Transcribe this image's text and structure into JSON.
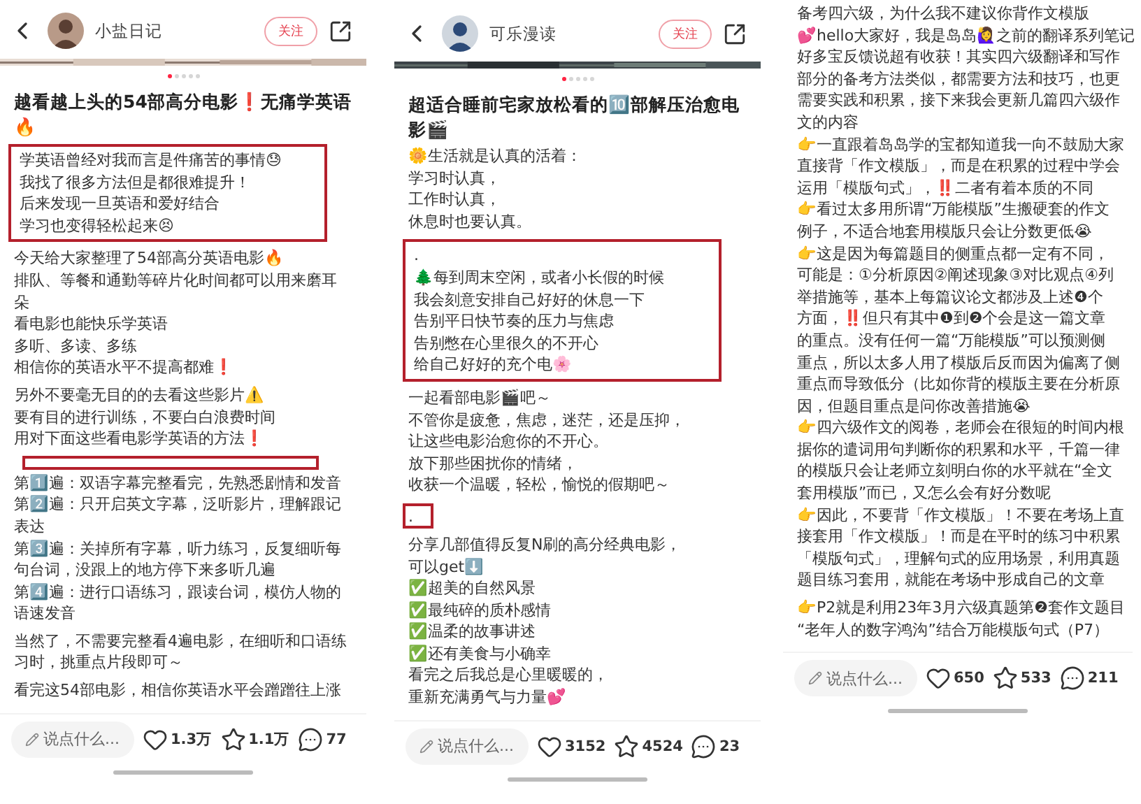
{
  "panels": [
    {
      "header": {
        "author": "小盐日记",
        "follow": "关注"
      },
      "image": {
        "kind": "picture"
      },
      "dots": [
        {
          "selected": true
        },
        {
          "selected": false
        },
        {
          "selected": false
        },
        {
          "selected": false
        },
        {
          "selected": false
        }
      ],
      "title": [
        "越看越上头的54部高分电影❗无痛学英语",
        "🔥"
      ],
      "blocks": [
        {
          "kind": "boxed",
          "lines": [
            "学英语曾经对我而言是件痛苦的事情😓",
            "我找了很多方法但是都很难提升！",
            "后来发现一旦英语和爱好结合",
            "学习也变得轻松起来😣"
          ]
        },
        {
          "kind": "para",
          "lines": [
            "今天给大家整理了54部高分英语电影🔥",
            "排队、等餐和通勤等碎片化时间都可以用来磨耳",
            "朵",
            "看电影也能快乐学英语",
            "多听、多读、多练",
            "相信你的英语水平不提高都难❗"
          ]
        },
        {
          "kind": "para",
          "lines": [
            "另外不要毫无目的的去看这些影片⚠️",
            "要有目的进行训练，不要白白浪费时间",
            "用对下面这些看电影学英语的方法❗"
          ]
        },
        {
          "kind": "empty_box"
        },
        {
          "kind": "para",
          "lines": [
            "第1️⃣遍：双语字幕完整看完，先熟悉剧情和发音",
            "第2️⃣遍：只开启英文字幕，泛听影片，理解跟记",
            "表达",
            "第3️⃣遍：关掉所有字幕，听力练习，反复细听每",
            "句台词，没跟上的地方停下来多听几遍",
            "第4️⃣遍：进行口语练习，跟读台词，模仿人物的",
            "语速发音"
          ]
        },
        {
          "kind": "para",
          "lines": [
            "当然了，不需要完整看4遍电影，在细听和口语练",
            "习时，挑重点片段即可～"
          ]
        },
        {
          "kind": "para",
          "lines": [
            "看完这54部电影，相信你英语水平会蹭蹭往上涨"
          ]
        }
      ],
      "footer": {
        "placeholder": "说点什么...",
        "likes": "1.3万",
        "favorites": "1.1万",
        "comments": "77"
      }
    },
    {
      "header": {
        "author": "可乐漫读",
        "follow": "关注"
      },
      "image": {
        "kind": "picture"
      },
      "dots": [
        {
          "selected": true
        },
        {
          "selected": false
        },
        {
          "selected": false
        },
        {
          "selected": false
        },
        {
          "selected": false
        }
      ],
      "title": [
        "超适合睡前宅家放松看的🔟部解压治愈电",
        "影🎬"
      ],
      "blocks": [
        {
          "kind": "para",
          "lines": [
            "🌼生活就是认真的活着：",
            "学习时认真，",
            "工作时认真，",
            "休息时也要认真。"
          ]
        },
        {
          "kind": "boxed",
          "lines": [
            ".",
            "🌲每到周末空闲，或者小长假的时候",
            "我会刻意安排自己好好的休息一下",
            "告别平日快节奏的压力与焦虑",
            "告别憋在心里很久的不开心",
            "给自己好好的充个电🌸"
          ]
        },
        {
          "kind": "para",
          "lines": [
            "一起看部电影🎬吧～",
            "不管你是疲惫，焦虑，迷茫，还是压抑，",
            "让这些电影治愈你的不开心。",
            "放下那些困扰你的情绪，",
            "收获一个温暖，轻松，愉悦的假期吧～"
          ]
        },
        {
          "kind": "boxed",
          "lines": [
            "."
          ]
        },
        {
          "kind": "para",
          "lines": [
            "分享几部值得反复N刷的高分经典电影，",
            "可以get⬇️",
            "✅超美的自然风景",
            "✅最纯碎的质朴感情",
            "✅温柔的故事讲述",
            "✅还有美食与小确幸",
            "看完之后我总是心里暖暖的，",
            "重新充满勇气与力量💕"
          ]
        }
      ],
      "footer": {
        "placeholder": "说点什么...",
        "likes": "3152",
        "favorites": "4524",
        "comments": "23"
      }
    },
    {
      "blocks": [
        {
          "kind": "para",
          "lines": [
            "备考四六级，为什么我不建议你背作文模版",
            "💕hello大家好，我是岛岛🙋‍♀️之前的翻译系列笔记",
            "好多宝反馈说超有收获！其实四六级翻译和写作",
            "部分的备考方法类似，都需要方法和技巧，也更",
            "需要实践和积累，接下来我会更新几篇四六级作",
            "文的内容",
            "👉一直跟着岛岛学的宝都知道我一向不鼓励大家",
            "直接背「作文模版」，而是在积累的过程中学会",
            "运用「模版句式」，‼️二者有着本质的不同",
            "👉看过太多用所谓“万能模版”生搬硬套的作文",
            "例子，不适合地套用模版只会让分数更低😭",
            "👉这是因为每篇题目的侧重点都一定有不同，",
            "可能是：①分析原因②阐述现象③对比观点④列",
            "举措施等，基本上每篇议论文都涉及上述❹个",
            "方面，‼️但只有其中❶到❷个会是这一篇文章",
            "的重点。没有任何一篇“万能模版”可以预测侧",
            "重点，所以太多人用了模版后反而因为偏离了侧",
            "重点而导致低分（比如你背的模版主要在分析原",
            "因，但题目重点是问你改善措施😭",
            "👉四六级作文的阅卷，老师会在很短的时间内根",
            "据你的遣词用句判断你的积累和水平，千篇一律",
            "的模版只会让老师立刻明白你的水平就在“全文",
            "套用模版”而已，又怎么会有好分数呢",
            "👉因此，不要背「作文模版」！不要在考场上直",
            "接套用「作文模版」！而是在平时的练习中积累",
            "「模版句式」，理解句式的应用场景，利用真题",
            "题目练习套用，就能在考场中形成自己的文章"
          ]
        },
        {
          "kind": "para",
          "lines": [
            "👉P2就是利用23年3月六级真题第❷套作文题目",
            "“老年人的数字鸿沟”结合万能模版句式（P7）"
          ]
        }
      ],
      "footer": {
        "placeholder": "说点什么...",
        "likes": "650",
        "favorites": "533",
        "comments": "211"
      }
    }
  ]
}
